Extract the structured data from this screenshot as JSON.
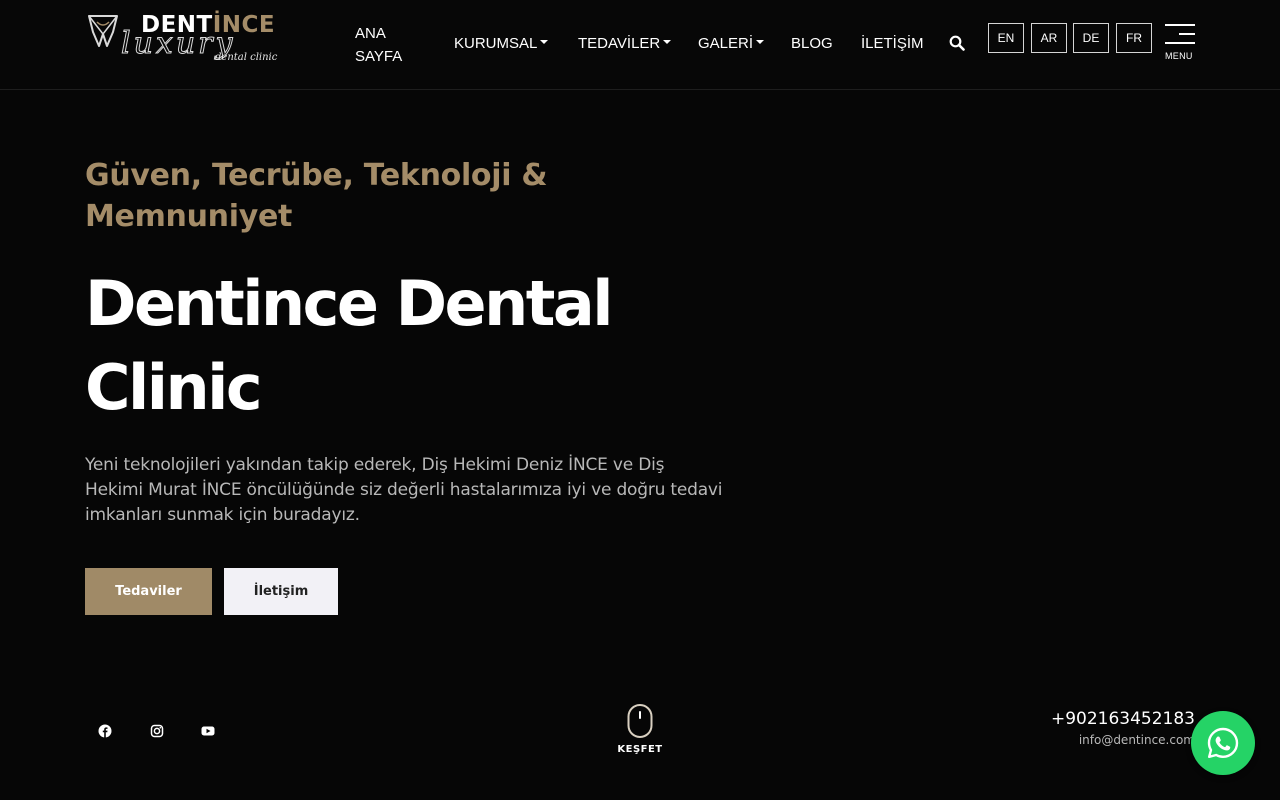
{
  "logo": {
    "brand_plain": "DENT",
    "brand_accent": "İNCE",
    "script": "luxury",
    "sub": "dental clinic",
    "icon": "tooth-logo-icon"
  },
  "nav": {
    "home": "ANA SAYFA",
    "corporate": "KURUMSAL",
    "treatments": "TEDAVİLER",
    "gallery": "GALERİ",
    "blog": "BLOG",
    "contact": "İLETİŞİM",
    "search_icon": "search-icon"
  },
  "languages": [
    "EN",
    "AR",
    "DE",
    "FR"
  ],
  "menu_label": "MENU",
  "hero": {
    "tagline": "Güven, Tecrübe, Teknoloji & Memnuniyet",
    "title": "Dentince Dental Clinic",
    "description": "Yeni teknolojileri yakından takip ederek, Diş Hekimi Deniz İNCE ve Diş Hekimi Murat İNCE öncülüğünde siz değerli hastalarımıza iyi ve doğru tedavi imkanları sunmak için buradayız.",
    "primary_button": "Tedaviler",
    "secondary_button": "İletişim"
  },
  "social": [
    "facebook-icon",
    "instagram-icon",
    "youtube-icon"
  ],
  "scroll_label": "KEŞFET",
  "contact": {
    "phone": "+902163452183",
    "email": "info@dentince.com"
  },
  "colors": {
    "accent": "#a48c68",
    "background": "#060606",
    "button_primary": "#a08a67",
    "button_secondary": "#f2f1f6",
    "whatsapp": "#25d366"
  }
}
